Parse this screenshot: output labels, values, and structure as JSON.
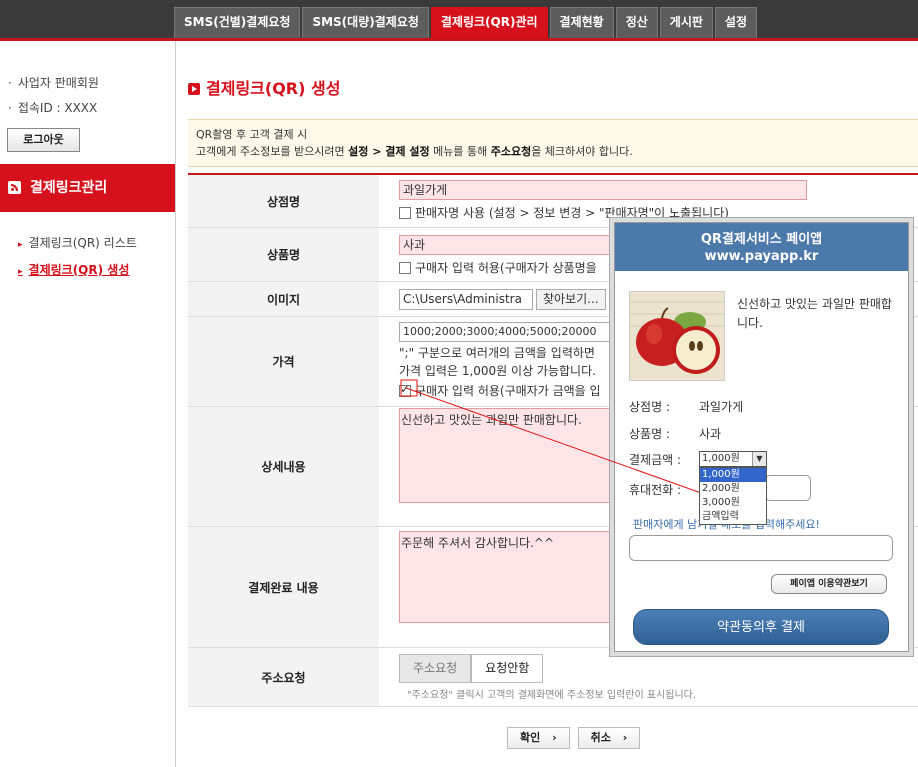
{
  "nav": {
    "tabs": [
      {
        "label": "SMS(건별)결제요청"
      },
      {
        "label": "SMS(대량)결제요청"
      },
      {
        "label": "결제링크(QR)관리"
      },
      {
        "label": "결제현황"
      },
      {
        "label": "정산"
      },
      {
        "label": "게시판"
      },
      {
        "label": "설정"
      }
    ]
  },
  "sidebar": {
    "member_type": "사업자 판매회원",
    "login_id": "접속ID : XXXX",
    "logout_label": "로그아웃",
    "section_title": "결제링크관리",
    "items": [
      {
        "label": "결제링크(QR) 리스트"
      },
      {
        "label": "결제링크(QR) 생성"
      }
    ]
  },
  "page": {
    "title": "결제링크(QR) 생성",
    "notice_line1": "QR촬영 후 고객 결제 시",
    "notice_line2_a": "고객에게 주소정보를 받으시려면 ",
    "notice_line2_b": "설정 > 결제 설정",
    "notice_line2_c": " 메뉴를 통해 ",
    "notice_line2_d": "주소요청",
    "notice_line2_e": "을 체크하셔야 합니다."
  },
  "form": {
    "shop_label": "상점명",
    "shop_value": "과일가게",
    "shop_option": "판매자명 사용 (설정 > 정보 변경 > \"판매자명\"이 노출됩니다)",
    "product_label": "상품명",
    "product_value": "사과",
    "product_option": "구매자 입력 허용(구매자가 상품명을",
    "image_label": "이미지",
    "image_path": "C:\\Users\\Administra",
    "image_browse": "찾아보기...",
    "price_label": "가격",
    "price_value": "1000;2000;3000;4000;5000;20000",
    "price_help1": "\";\" 구분으로 여러개의 금액을 입력하면",
    "price_help2": "가격 입력은 1,000원 이상 가능합니다.",
    "price_option": "구매자 입력 허용(구매자가 금액을 입",
    "detail_label": "상세내용",
    "detail_value": "신선하고 맛있는 과일만 판매합니다.",
    "complete_label": "결제완료 내용",
    "complete_value": "주문해 주셔서 감사합니다.^^",
    "address_label": "주소요청",
    "address_opt1": "주소요청",
    "address_opt2": "요청안함",
    "address_help": "\"주소요청\" 클릭시 고객의 결제화면에 주소정보 입력란이 표시됩니다.",
    "confirm_label": "확인",
    "cancel_label": "취소"
  },
  "popup": {
    "title1": "QR결제서비스 페이앱",
    "title2": "www.payapp.kr",
    "description": "신선하고 맛있는 과일만 판매합니다.",
    "shop_label": "상점명 :",
    "shop_value": "과일가게",
    "product_label": "상품명 :",
    "product_value": "사과",
    "amount_label": "결제금액 :",
    "amount_selected": "1,000원",
    "amount_options": [
      "1,000원",
      "2,000원",
      "3,000원",
      "금액입력"
    ],
    "phone_label": "휴대전화 :",
    "message_label": "판매자에게 남기실 메모를 입력해주세요!",
    "terms_label": "페이앱 이용약관보기",
    "pay_label": "약관동의후 결제"
  },
  "colors": {
    "accent": "#d6111c",
    "popup_blue": "#4b79aa"
  }
}
